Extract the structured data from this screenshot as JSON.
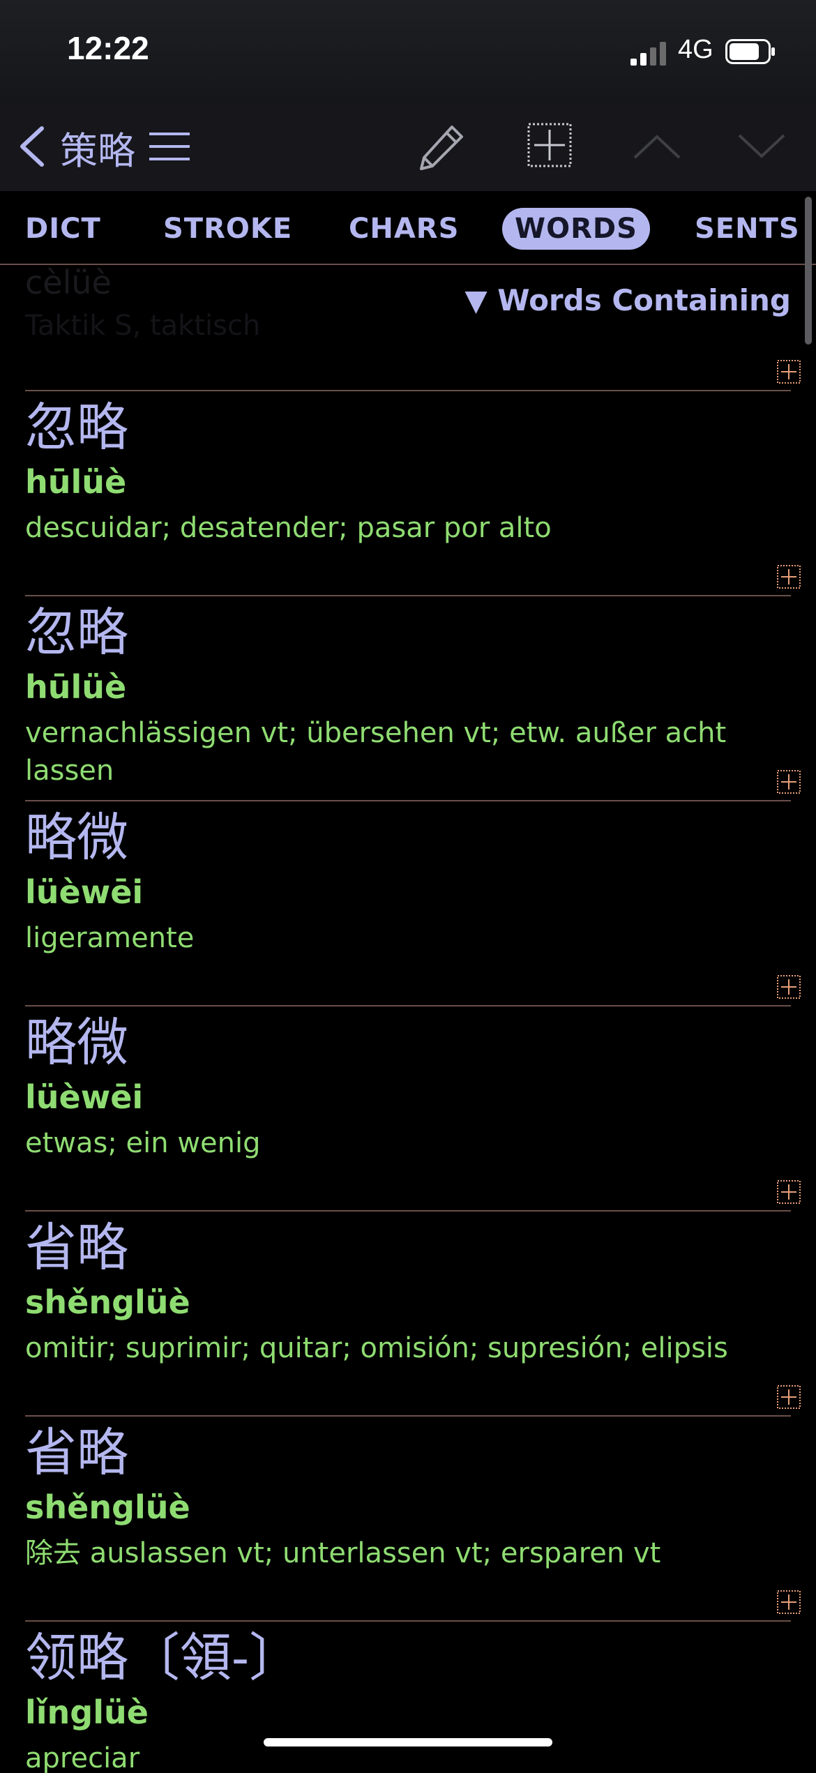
{
  "status": {
    "time": "12:22",
    "network": "4G"
  },
  "nav": {
    "title": "策略"
  },
  "tabs": [
    {
      "label": "DICT",
      "active": false
    },
    {
      "label": "STROKE",
      "active": false
    },
    {
      "label": "CHARS",
      "active": false
    },
    {
      "label": "WORDS",
      "active": true
    },
    {
      "label": "SENTS",
      "active": false
    }
  ],
  "ghost_header": {
    "hanzi": "策略",
    "pinyin": "cèlüè",
    "definition": "Taktik S, taktisch"
  },
  "section_heading": "▼ Words Containing",
  "entries": [
    {
      "hanzi": "忽略",
      "pinyin": "hūlüè",
      "definition": "descuidar; desatender; pasar por alto"
    },
    {
      "hanzi": "忽略",
      "pinyin": "hūlüè",
      "definition": "vernachlässigen vt; übersehen vt; etw. außer acht lassen"
    },
    {
      "hanzi": "略微",
      "pinyin": "lüèwēi",
      "definition": "ligeramente"
    },
    {
      "hanzi": "略微",
      "pinyin": "lüèwēi",
      "definition": "etwas; ein wenig"
    },
    {
      "hanzi": "省略",
      "pinyin": "shěnglüè",
      "definition": "omitir; suprimir; quitar; omisión; supresión; elipsis"
    },
    {
      "hanzi": "省略",
      "pinyin": "shěnglüè",
      "definition": "除去 auslassen vt; unterlassen vt; ersparen vt"
    },
    {
      "hanzi": "领略〔領-〕",
      "pinyin": "lǐnglüè",
      "definition": "apreciar"
    }
  ],
  "colors": {
    "accent": "#b4b7ef",
    "pinyin": "#8fdc72",
    "divider": "#6b4f4a",
    "plus_box": "#e9a07a"
  }
}
